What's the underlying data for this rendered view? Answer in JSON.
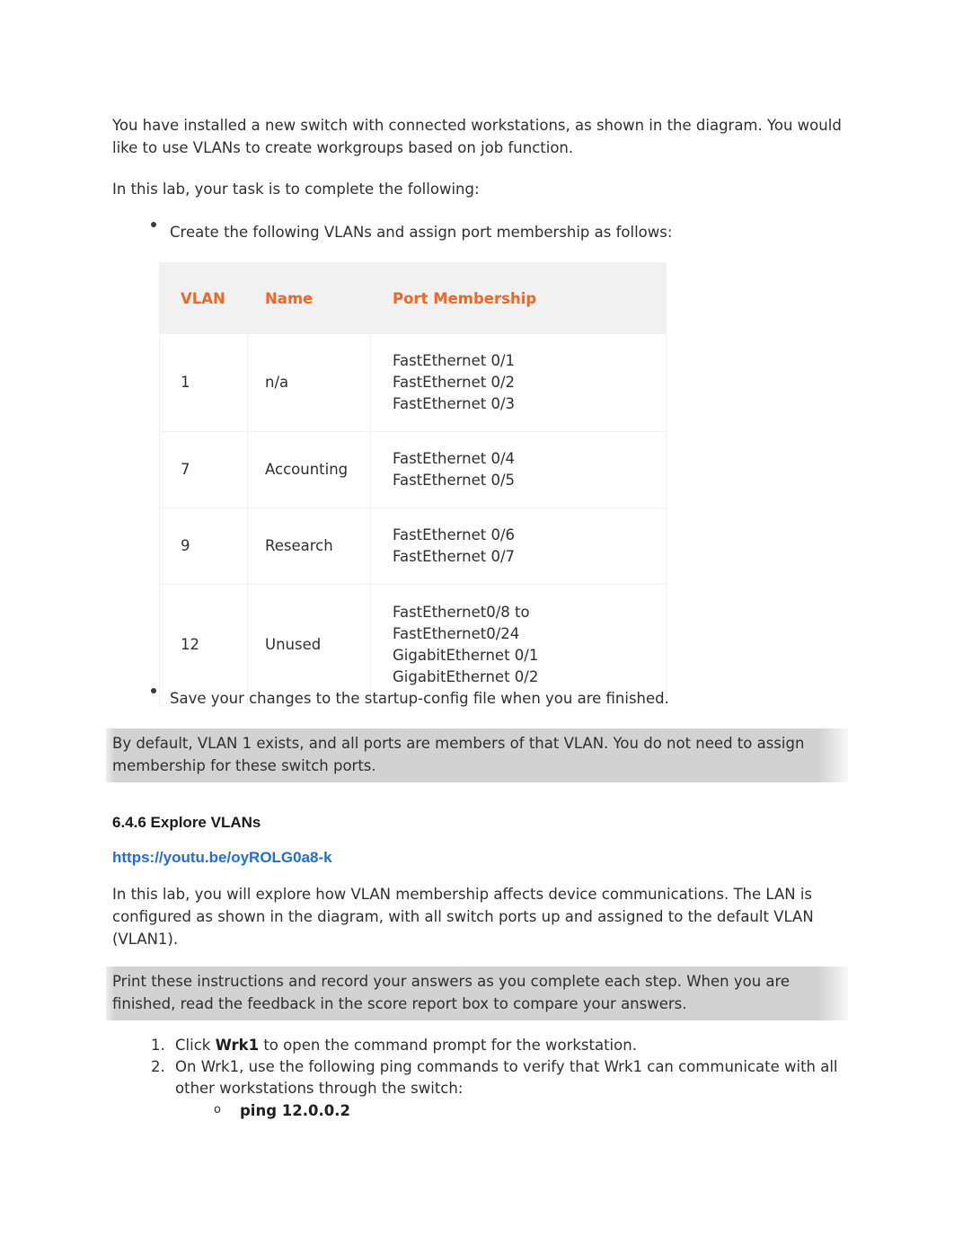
{
  "document": {
    "intro_paragraph": "You have installed a new switch with connected workstations, as shown in the diagram. You would like to use VLANs to create workgroups based on job function.",
    "task_lead_in": "In this lab, your task is to complete the following:",
    "bullets": [
      "Create the following VLANs and assign port membership as follows:",
      "Save your changes to the startup-config file when you are finished."
    ],
    "vlan_table": {
      "headers": [
        "VLAN",
        "Name",
        "Port Membership"
      ],
      "rows": [
        {
          "vlan": "1",
          "name": "n/a",
          "ports": [
            "FastEthernet 0/1",
            "FastEthernet 0/2",
            "FastEthernet 0/3"
          ]
        },
        {
          "vlan": "7",
          "name": "Accounting",
          "ports": [
            "FastEthernet 0/4",
            "FastEthernet 0/5"
          ]
        },
        {
          "vlan": "9",
          "name": "Research",
          "ports": [
            "FastEthernet 0/6",
            "FastEthernet 0/7"
          ]
        },
        {
          "vlan": "12",
          "name": "Unused",
          "ports": [
            "FastEthernet0/8 to",
            "FastEthernet0/24",
            "GigabitEthernet 0/1",
            "GigabitEthernet 0/2"
          ]
        }
      ]
    },
    "note_one": "By default, VLAN 1 exists, and all ports are members of that VLAN. You do not need to assign membership for these switch ports.",
    "section": {
      "heading": "6.4.6 Explore VLANs",
      "link_text": "https://youtu.be/oyROLG0a8-k"
    },
    "lab_paragraph": "In this lab, you will explore how VLAN membership affects device communications. The LAN is configured as shown in the diagram, with all switch ports up and assigned to the default VLAN (VLAN1).",
    "note_two": "Print these instructions and record your answers as you complete each step. When you are finished, read the feedback in the score report box to compare your answers.",
    "steps": [
      {
        "number": "1.",
        "prefix": "Click ",
        "bold": "Wrk1",
        "suffix": " to open the command prompt for the workstation."
      },
      {
        "number": "2.",
        "prefix": "",
        "bold": "",
        "suffix": "On Wrk1, use the following ping commands to verify that Wrk1 can communicate with all other workstations through the switch:"
      }
    ],
    "sub_step": {
      "marker": "o",
      "command": "ping 12.0.0.2"
    }
  },
  "colors": {
    "table_header_orange": "#F26522",
    "link_blue": "#1F6FD0",
    "highlight_grey": "#CFCFCF",
    "body_text": "#2F2F2F"
  }
}
